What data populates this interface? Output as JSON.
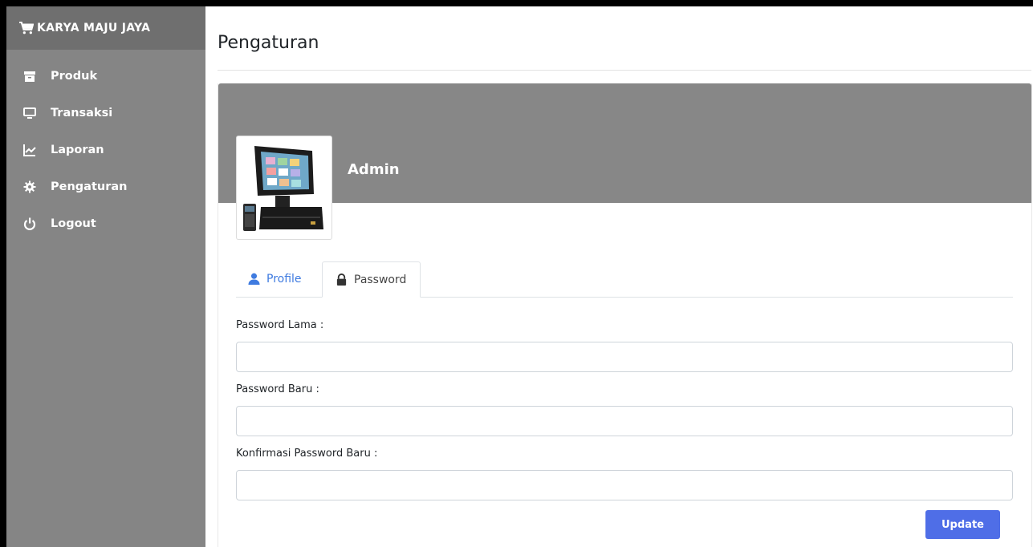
{
  "brand": {
    "name": "KARYA MAJU JAYA",
    "icon": "shopping-cart-icon"
  },
  "sidebar": {
    "items": [
      {
        "label": "Produk",
        "icon": "archive-box-icon"
      },
      {
        "label": "Transaksi",
        "icon": "desktop-monitor-icon"
      },
      {
        "label": "Laporan",
        "icon": "line-chart-icon"
      },
      {
        "label": "Pengaturan",
        "icon": "gear-icon"
      },
      {
        "label": "Logout",
        "icon": "power-icon"
      }
    ]
  },
  "page": {
    "title": "Pengaturan"
  },
  "profile": {
    "name": "Admin",
    "avatar": "pos-terminal-image"
  },
  "tabs": [
    {
      "label": "Profile",
      "icon": "user-icon",
      "active": false
    },
    {
      "label": "Password",
      "icon": "lock-icon",
      "active": true
    }
  ],
  "form": {
    "old_password_label": "Password Lama :",
    "old_password_value": "",
    "new_password_label": "Password Baru :",
    "new_password_value": "",
    "confirm_password_label": "Konfirmasi Password Baru :",
    "confirm_password_value": "",
    "submit_label": "Update"
  },
  "colors": {
    "sidebar": "#858585",
    "brand_bar": "#6f6f6f",
    "cover": "#878787",
    "accent": "#4f6ee7",
    "tab_link": "#3f7be0"
  }
}
